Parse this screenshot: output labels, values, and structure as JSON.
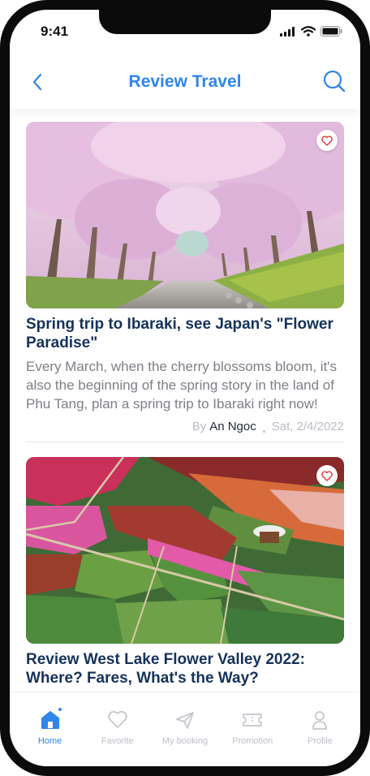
{
  "status_bar": {
    "time": "9:41"
  },
  "header": {
    "title": "Review Travel",
    "back_icon": "chevron-left-icon",
    "search_icon": "search-icon"
  },
  "colors": {
    "accent": "#2f86e8",
    "title": "#15325a",
    "muted": "#7d7f86"
  },
  "articles": [
    {
      "title": "Spring trip to Ibaraki, see Japan's \"Flower Paradise\"",
      "excerpt": "Every March, when the cherry blossoms bloom, it's also the beginning of the spring story in the land of Phu Tang, plan a spring trip to Ibaraki right now!",
      "by_label": "By",
      "author": "An Ngoc",
      "date": "Sat, 2/4/2022",
      "image": "cherry-blossom-alley-photo"
    },
    {
      "title": "Review West Lake Flower Valley 2022: Where? Fares, What's the Way?",
      "image": "flower-valley-aerial-photo"
    }
  ],
  "tab_bar": {
    "tabs": [
      {
        "label": "Home",
        "icon": "home-icon",
        "active": true
      },
      {
        "label": "Favorite",
        "icon": "heart-icon",
        "active": false
      },
      {
        "label": "My booking",
        "icon": "send-icon",
        "active": false
      },
      {
        "label": "Promotion",
        "icon": "ticket-icon",
        "active": false
      },
      {
        "label": "Profile",
        "icon": "user-icon",
        "active": false
      }
    ]
  }
}
